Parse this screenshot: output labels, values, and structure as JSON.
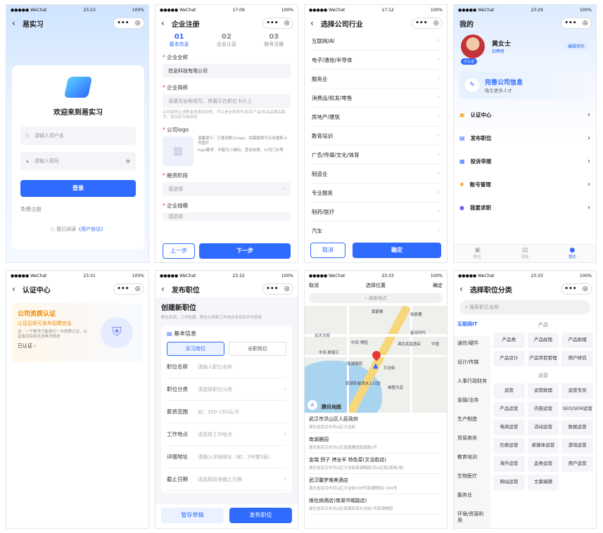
{
  "status": {
    "carrier": "●●●●● WeChat",
    "battery": "100%"
  },
  "s1": {
    "time": "23:23",
    "title": "易实习",
    "welcome": "欢迎来到易实习",
    "user_ph": "请输入用户名",
    "pwd_ph": "请输入密码",
    "login": "登录",
    "free": "免费注册",
    "agree": "我已阅读",
    "proto": "《用户协议》"
  },
  "s2": {
    "time": "17:09",
    "title": "企业注册",
    "steps": [
      {
        "n": "01",
        "t": "基本信息"
      },
      {
        "n": "02",
        "t": "企业认证"
      },
      {
        "n": "03",
        "t": "账号注册"
      }
    ],
    "full_label": "企业全称",
    "full_val": "信息科技有限公司",
    "short_label": "企业简称",
    "short_ph": "请填写全称简写，将展示在职位卡片上",
    "short_hint": "公司简称让求职者快速找到你，可以是全称简写/知名产品/知名品牌关键字，提交后不能修改",
    "logo_label": "公司logo",
    "logo_hint1": "温馨提示：已使用默认logo，如需替换可点击重新上传图片",
    "logo_hint2": "logo要求：不能为二维码，营业执照，公司门头等",
    "stage_label": "融资阶段",
    "stage_ph": "请选择",
    "scale_label": "企业规模",
    "scale_ph": "请选择",
    "prev": "上一步",
    "next": "下一步"
  },
  "s3": {
    "time": "17:12",
    "title": "选择公司行业",
    "items": [
      "互联网/AI",
      "电子/通信/半导体",
      "服务业",
      "消费品/批发/零售",
      "房地产/建筑",
      "教育培训",
      "广告/传媒/文化/体育",
      "制造业",
      "专业服务",
      "制药/医疗",
      "汽车"
    ],
    "cancel": "取消",
    "ok": "确定"
  },
  "s4": {
    "time": "23:29",
    "title": "我的",
    "name": "黄女士",
    "role": "招聘者",
    "verified": "已认证",
    "edit": "编辑资料",
    "card_title": "完善公司信息",
    "card_sub": "吸引更多人才",
    "menu": [
      "认证中心",
      "发布职位",
      "投诉举报",
      "账号管理",
      "我要求职"
    ],
    "tabs": [
      "职位",
      "消息",
      "我的"
    ]
  },
  "s5": {
    "time": "23:31",
    "title": "认证中心",
    "h": "公司资质认证",
    "sub": "认证后即可发布招聘信息",
    "note": "注：一个账号只能进行一次资质认证，认证成功后将无法再次修改",
    "status": "已认证"
  },
  "s6": {
    "time": "23:32",
    "title": "发布职位",
    "h": "创建新职位",
    "sub": "职位名称、工作性质、职位分类和工作地点发布后不可修改",
    "section": "基本信息",
    "t1": "实习岗位",
    "t2": "全职岗位",
    "fields": [
      {
        "l": "职位名称",
        "v": "请输入职位名称"
      },
      {
        "l": "职位分类",
        "v": "请选择职位分类"
      },
      {
        "l": "薪资范围",
        "v": "如：100-150元/天"
      },
      {
        "l": "工作地点",
        "v": "请选择工作地点"
      },
      {
        "l": "详细地址",
        "v": "请输入详细地址（如：3号楼5层）"
      },
      {
        "l": "截止日期",
        "v": "请选择投递截止日期"
      }
    ],
    "draft": "暂存草稿",
    "publish": "发布职位"
  },
  "s7": {
    "time": "23:33",
    "cancel": "取消",
    "title": "选择位置",
    "ok": "确定",
    "search": "搜索地点",
    "map_labels": [
      "黄鹤楼",
      "关天大街",
      "星光时代",
      "中百·邮家汇",
      "湖北武昌酒店",
      "中百·博园",
      "南湖雅园",
      "文治街",
      "南湖幸福湾水上公园",
      "雄楚大道",
      "中国",
      "徐家棚"
    ],
    "maplogo": "腾讯地图",
    "results": [
      {
        "n": "武汉市洪山区人民政府",
        "a": "湖北省武汉市洪山区文治街"
      },
      {
        "n": "南湖雅园",
        "a": "湖北省武汉市洪山区南湖雅园南湖路2号"
      },
      {
        "n": "金瑞 鸽子 烤全羊 特色菜(文治街店)",
        "a": "湖北省武汉市洪山区文治街南湖雅园(洪山区段)南侧(南)"
      },
      {
        "n": "武汉馨梦难美酒店",
        "a": "湖北省武汉市洪山区文治街508号南湖雅园2-104号"
      },
      {
        "n": "维也纳酒店(南湖书城路店)",
        "a": "湖北省武汉市洪山区南湖街道文治街1号南湖雅园"
      }
    ]
  },
  "s8": {
    "time": "23:33",
    "title": "选择职位分类",
    "search": "搜索职位名称",
    "cats": [
      "互联网IT",
      "通信/硬件",
      "设计/传媒",
      "人事行政财务",
      "金融/法务",
      "生产制造",
      "贸易商务",
      "教育培训",
      "生物医疗",
      "服务业",
      "环境/资源利用"
    ],
    "g1": "产品",
    "p1": [
      "产品类",
      "产品经理",
      "产品助理",
      "产品设计",
      "产品项目管理",
      "用户研究"
    ],
    "g2": "运营",
    "p2": [
      "运营",
      "运营助理",
      "运营专员",
      "产品运营",
      "内容运营",
      "SEO/SEM运营",
      "电商运营",
      "活动运营",
      "数据运营",
      "社群运营",
      "新媒体运营",
      "游戏运营",
      "海外运营",
      "品类运营",
      "用户运营",
      "网站运营",
      "文案编辑"
    ]
  }
}
